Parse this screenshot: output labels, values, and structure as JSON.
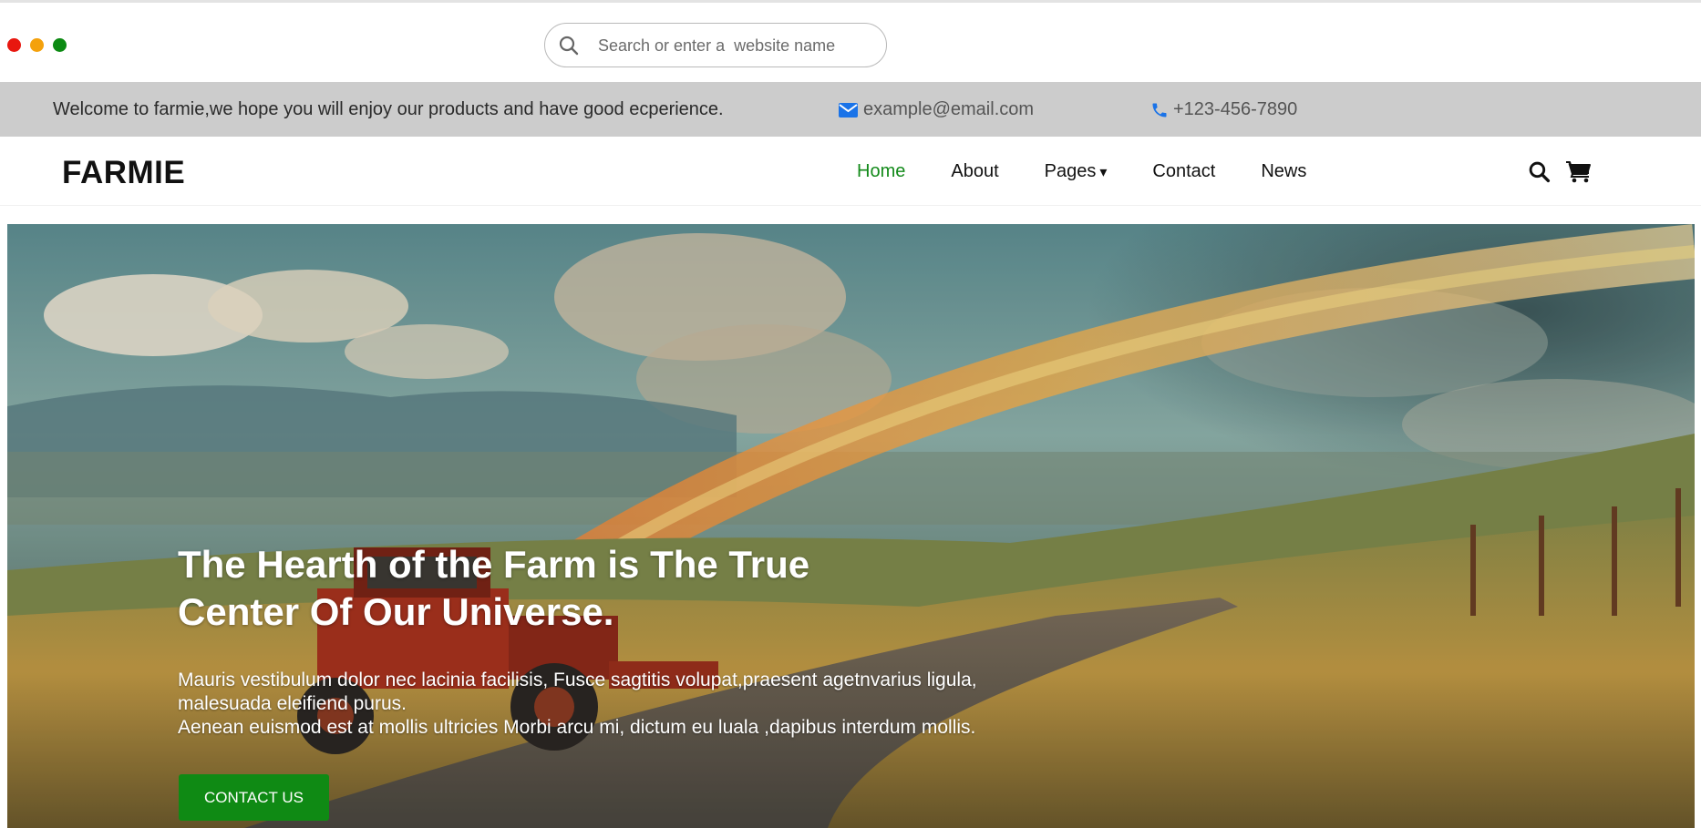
{
  "browser": {
    "window_controls": [
      "close",
      "minimize",
      "maximize"
    ],
    "search": {
      "placeholder": "Search or enter a  website name",
      "value": "",
      "icon": "search-icon"
    }
  },
  "topbar": {
    "welcome_text": "Welcome to farmie,we hope you will enjoy our products and have good ecperience.",
    "email": "example@email.com",
    "email_icon": "envelope-icon",
    "phone": "+123-456-7890",
    "phone_icon": "phone-icon",
    "icon_color": "#1a73e8"
  },
  "navbar": {
    "logo": "FARMIE",
    "links": [
      {
        "label": "Home",
        "active": true
      },
      {
        "label": "About"
      },
      {
        "label": "Pages",
        "dropdown": true,
        "caret": "▾"
      },
      {
        "label": "Contact"
      },
      {
        "label": "News"
      }
    ],
    "active_color": "#138a1a",
    "icons": [
      "search-icon",
      "cart-icon"
    ]
  },
  "hero": {
    "title_line1": "The Hearth of the Farm is The True",
    "title_line2": "Center Of Our Universe.",
    "body_line1": "Mauris vestibulum dolor nec lacinia facilisis, Fusce sagtitis volupat,praesent agetnvarius ligula,",
    "body_line2": "malesuada eleifiend purus.",
    "body_line3": "Aenean euismod est at mollis ultricies Morbi arcu mi, dictum eu luala ,dapibus interdum mollis.",
    "cta_label": "CONTACT US",
    "cta_color": "#0f8a14",
    "background": "farm landscape with rainbow and red tractor"
  }
}
